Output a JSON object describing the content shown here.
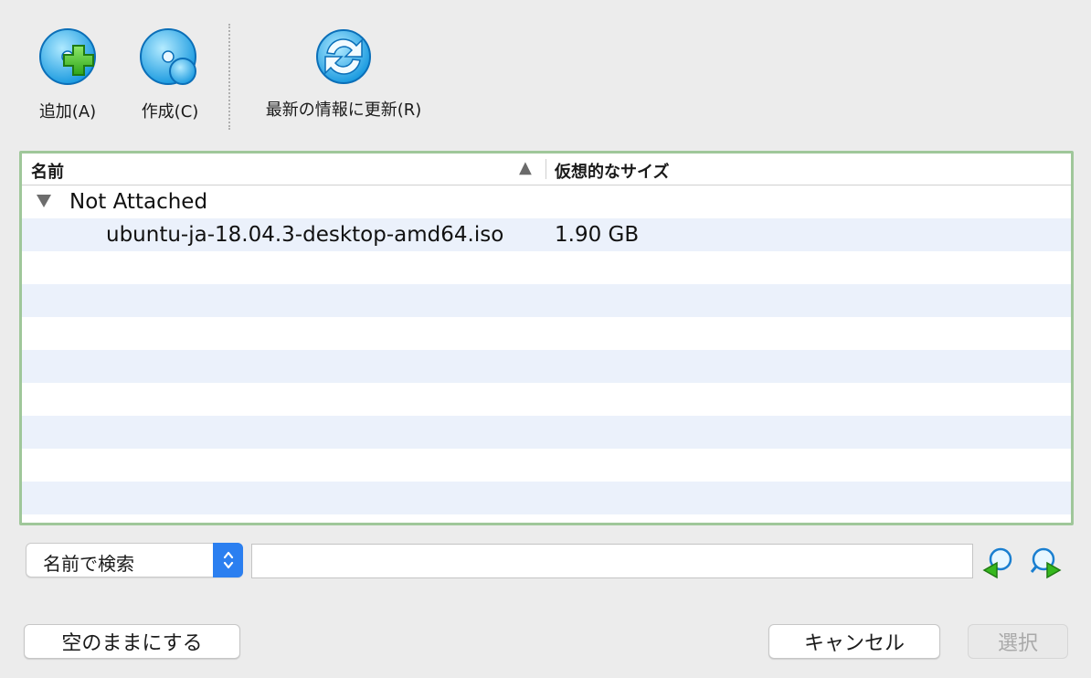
{
  "toolbar": {
    "add_label": "追加(A)",
    "create_label": "作成(C)",
    "refresh_label": "最新の情報に更新(R)"
  },
  "table": {
    "columns": [
      "名前",
      "仮想的なサイズ"
    ],
    "sort_indicator": "▲",
    "groups": [
      {
        "label": "Not Attached",
        "items": [
          {
            "name": "ubuntu-ja-18.04.3-desktop-amd64.iso",
            "size": "1.90 GB"
          }
        ]
      }
    ]
  },
  "search": {
    "mode": "名前で検索",
    "value": ""
  },
  "buttons": {
    "leave_empty": "空のままにする",
    "cancel": "キャンセル",
    "choose": "選択"
  },
  "colors": {
    "focus_border": "#9fc79a",
    "alt_row": "#ebf1fb",
    "accent": "#2b7ff0"
  }
}
